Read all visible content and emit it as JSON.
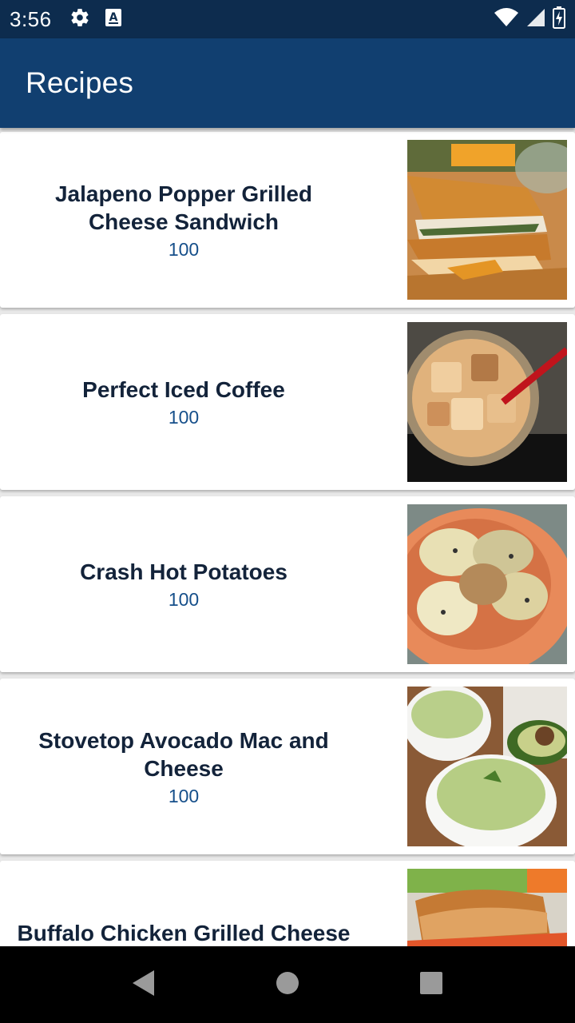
{
  "status_bar": {
    "time": "3:56",
    "icons": [
      "settings-icon",
      "font-a-icon",
      "wifi-icon",
      "cell-signal-icon",
      "battery-charging-icon"
    ]
  },
  "app_bar": {
    "title": "Recipes"
  },
  "recipes": [
    {
      "title": "Jalapeno Popper Grilled Cheese Sandwich",
      "count": "100",
      "image": "grilled-cheese-photo"
    },
    {
      "title": "Perfect Iced Coffee",
      "count": "100",
      "image": "iced-coffee-photo"
    },
    {
      "title": "Crash Hot Potatoes",
      "count": "100",
      "image": "potatoes-photo"
    },
    {
      "title": "Stovetop Avocado Mac and Cheese",
      "count": "100",
      "image": "mac-and-cheese-photo"
    },
    {
      "title": "Buffalo Chicken Grilled Cheese Sandwich",
      "count": "",
      "image": "buffalo-sandwich-photo"
    }
  ],
  "nav_bar": {
    "icons": [
      "back-icon",
      "home-icon",
      "recents-icon"
    ]
  },
  "colors": {
    "status_bar": "#0d2c4e",
    "app_bar": "#113f70",
    "title_text": "#13233a",
    "count_text": "#164f8a"
  }
}
